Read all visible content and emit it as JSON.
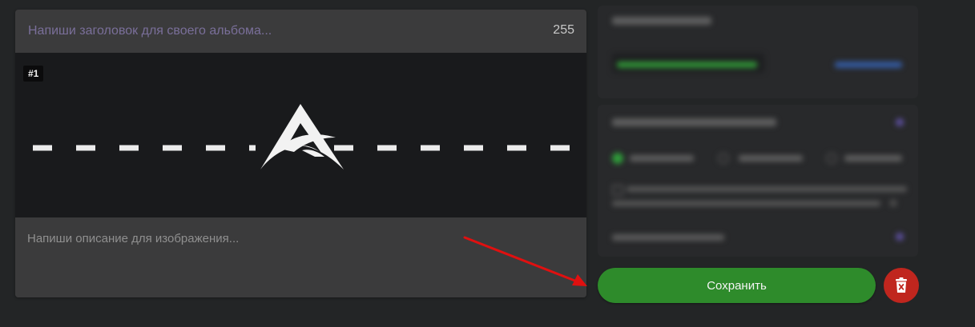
{
  "album": {
    "title_placeholder": "Напиши заголовок для своего альбома...",
    "char_counter": "255",
    "image_badge": "#1",
    "description_placeholder": "Напиши описание для изображения..."
  },
  "actions": {
    "save_label": "Сохранить"
  },
  "colors": {
    "save_green": "#2e8b2b",
    "delete_red": "#c0261e",
    "annotation_arrow": "#e01010"
  },
  "icons": {
    "delete": "trash-icon",
    "image": "logo-mark"
  }
}
